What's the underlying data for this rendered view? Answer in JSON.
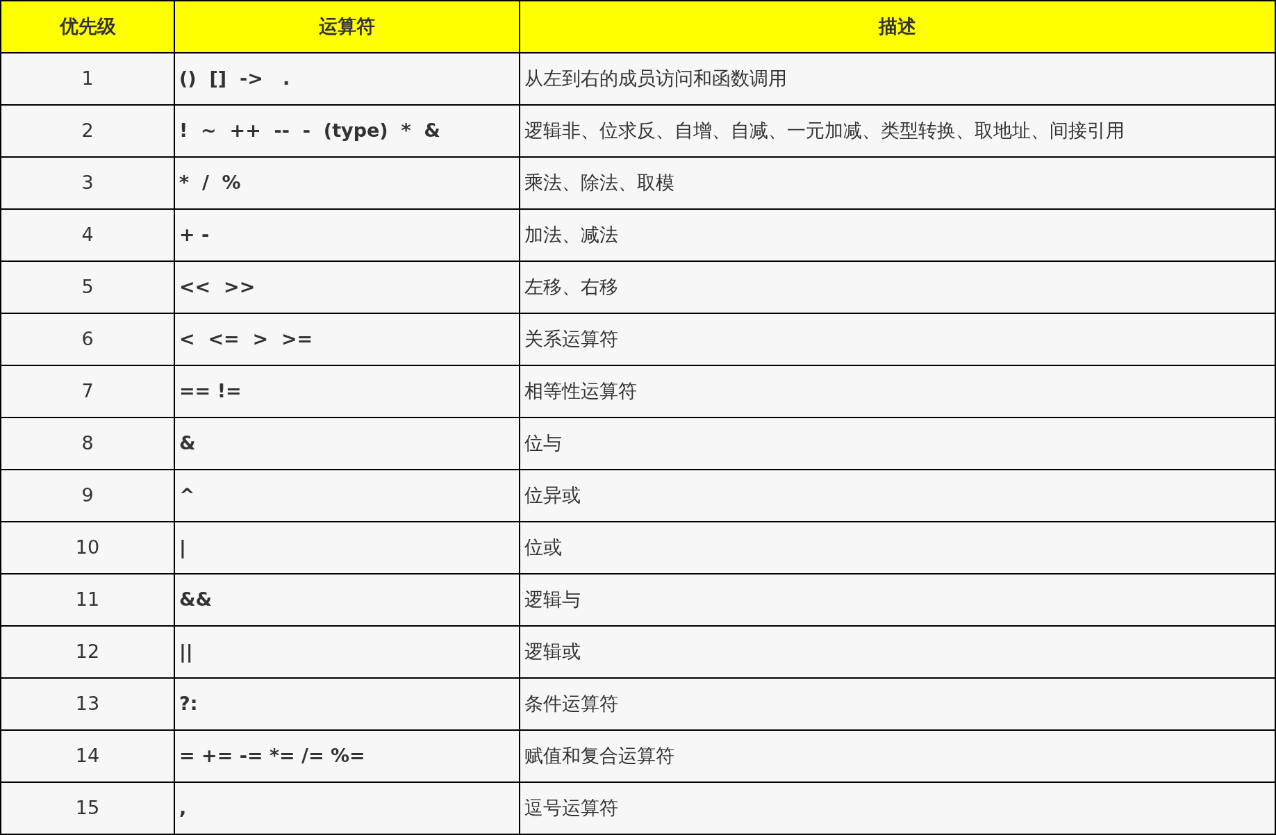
{
  "table": {
    "columns": [
      "优先级",
      "运算符",
      "描述"
    ],
    "rows": [
      {
        "priority": "1",
        "operators": "()  []  ->   .",
        "description": "从左到右的成员访问和函数调用"
      },
      {
        "priority": "2",
        "operators": "!  ~  ++  --  -  (type)  *  &",
        "description": "逻辑非、位求反、自增、自减、一元加减、类型转换、取地址、间接引用"
      },
      {
        "priority": "3",
        "operators": "*  /  %",
        "description": "乘法、除法、取模"
      },
      {
        "priority": "4",
        "operators": "+ -",
        "description": "加法、减法"
      },
      {
        "priority": "5",
        "operators": "<<  >>",
        "description": "左移、右移"
      },
      {
        "priority": "6",
        "operators": "<  <=  >  >=",
        "description": "关系运算符"
      },
      {
        "priority": "7",
        "operators": "== !=",
        "description": "相等性运算符"
      },
      {
        "priority": "8",
        "operators": "&",
        "description": "位与"
      },
      {
        "priority": "9",
        "operators": "^",
        "description": "位异或"
      },
      {
        "priority": "10",
        "operators": "|",
        "description": "位或"
      },
      {
        "priority": "11",
        "operators": "&&",
        "description": "逻辑与"
      },
      {
        "priority": "12",
        "operators": "||",
        "description": "逻辑或"
      },
      {
        "priority": "13",
        "operators": "?:",
        "description": "条件运算符"
      },
      {
        "priority": "14",
        "operators": "= += -= *= /= %=",
        "description": "赋值和复合运算符"
      },
      {
        "priority": "15",
        "operators": ",",
        "description": "逗号运算符"
      }
    ]
  }
}
